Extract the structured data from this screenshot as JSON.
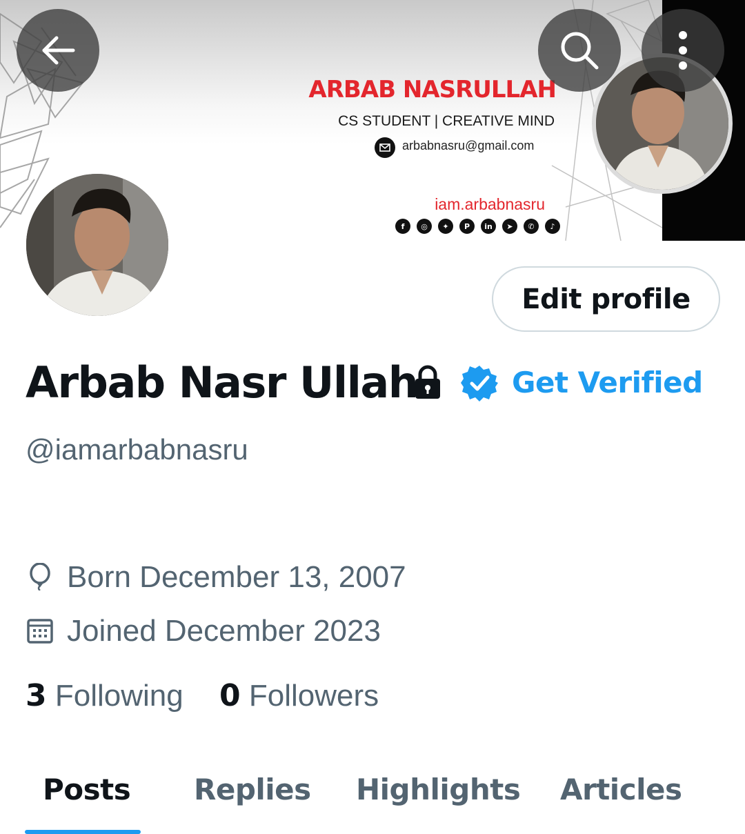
{
  "banner": {
    "title": "ARBAB NASRULLAH",
    "subtitle": "CS STUDENT | CREATIVE MIND",
    "email": "arbabnasru@gmail.com",
    "handle": "iam.arbabnasru",
    "socials": [
      {
        "icon": "facebook-icon",
        "glyph": "f"
      },
      {
        "icon": "instagram-icon",
        "glyph": "◎"
      },
      {
        "icon": "twitter-icon",
        "glyph": "✦"
      },
      {
        "icon": "pinterest-icon",
        "glyph": "P"
      },
      {
        "icon": "linkedin-icon",
        "glyph": "in"
      },
      {
        "icon": "telegram-icon",
        "glyph": "➤"
      },
      {
        "icon": "whatsapp-icon",
        "glyph": "✆"
      },
      {
        "icon": "tiktok-icon",
        "glyph": "♪"
      }
    ]
  },
  "header": {
    "back_icon": "arrow-left-icon",
    "search_icon": "search-icon",
    "more_icon": "more-vertical-icon"
  },
  "profile": {
    "edit_label": "Edit profile",
    "name": "Arbab Nasr Ullah",
    "get_verified": "Get Verified",
    "handle": "@iamarbabnasru",
    "born": "Born December 13, 2007",
    "joined": "Joined December 2023",
    "following_count": "3",
    "following_label": "Following",
    "followers_count": "0",
    "followers_label": "Followers"
  },
  "tabs": [
    {
      "label": "Posts",
      "active": true
    },
    {
      "label": "Replies",
      "active": false
    },
    {
      "label": "Highlights",
      "active": false
    },
    {
      "label": "Articles",
      "active": false
    }
  ],
  "colors": {
    "accent": "#1d9bf0",
    "text_primary": "#0f1419",
    "text_secondary": "#536471",
    "banner_red": "#e3262d"
  }
}
